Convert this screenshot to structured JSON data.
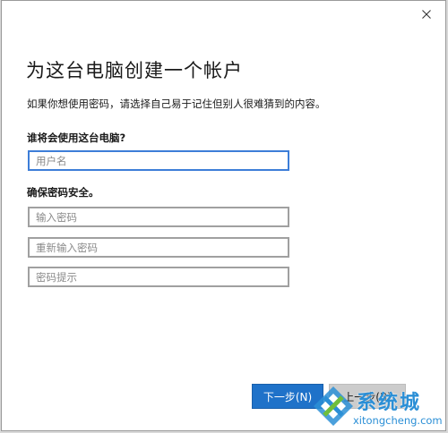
{
  "dialog": {
    "title": "为这台电脑创建一个帐户",
    "subtitle": "如果你想使用密码，请选择自己易于记住但别人很难猜到的内容。"
  },
  "user_section": {
    "label": "谁将会使用这台电脑?",
    "username": {
      "value": "",
      "placeholder": "用户名"
    }
  },
  "password_section": {
    "label": "确保密码安全。",
    "password": {
      "value": "",
      "placeholder": "输入密码"
    },
    "confirm": {
      "value": "",
      "placeholder": "重新输入密码"
    },
    "hint": {
      "value": "",
      "placeholder": "密码提示"
    }
  },
  "buttons": {
    "next": "下一步(N)",
    "back": "上一步(B)"
  },
  "watermark": {
    "brand": "系统城",
    "url": "xitongcheng.com",
    "color": "#2b8fd6"
  },
  "colors": {
    "accent": "#1f72c9",
    "focus_border": "#3d7ed8"
  },
  "icons": {
    "close": "close-icon"
  }
}
